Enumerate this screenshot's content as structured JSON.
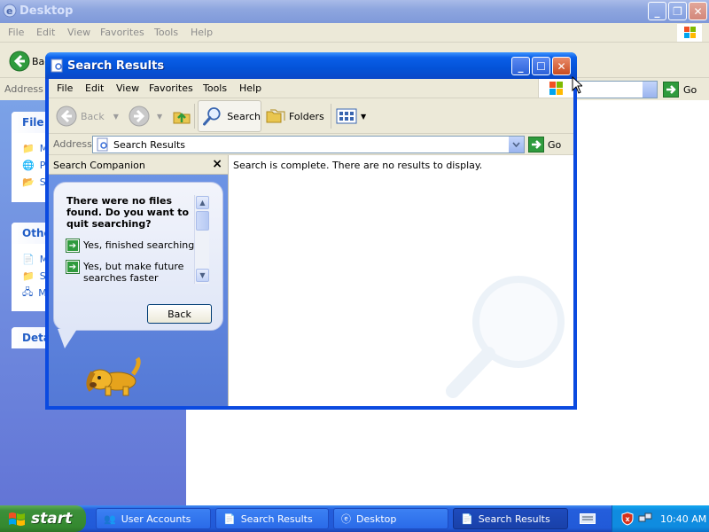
{
  "background_window": {
    "title": "Desktop",
    "menu": [
      "File",
      "Edit",
      "View",
      "Favorites",
      "Tools",
      "Help"
    ],
    "back_label": "Back",
    "address_label": "Address",
    "go_label": "Go",
    "task_boxes": [
      {
        "header": "File a",
        "items": [
          "M",
          "P",
          "S"
        ]
      },
      {
        "header": "Othe",
        "items": [
          "M",
          "S",
          "M"
        ]
      },
      {
        "header": "Deta",
        "items": []
      }
    ]
  },
  "search_window": {
    "title": "Search Results",
    "menu": [
      "File",
      "Edit",
      "View",
      "Favorites",
      "Tools",
      "Help"
    ],
    "toolbar": {
      "back": "Back",
      "search": "Search",
      "folders": "Folders"
    },
    "address": {
      "label": "Address",
      "value": "Search Results",
      "go": "Go"
    },
    "companion": {
      "header": "Search Companion",
      "close_glyph": "×",
      "question": "There were no files found.  Do you want to quit searching?",
      "options": [
        "Yes, finished searching",
        "Yes, but make future searches faster"
      ],
      "back_button": "Back"
    },
    "results_message": "Search is complete. There are no results to display."
  },
  "taskbar": {
    "start_label": "start",
    "tasks": [
      {
        "label": "User Accounts",
        "active": false
      },
      {
        "label": "Search Results",
        "active": false
      },
      {
        "label": "Desktop",
        "active": false
      },
      {
        "label": "Search Results",
        "active": true
      }
    ],
    "clock": "10:40 AM"
  },
  "colors": {
    "title_active": "#0453d8",
    "title_inactive": "#8ea6df",
    "taskbar": "#245edc",
    "start_green": "#3c8f3a",
    "tray": "#0f8ce0"
  }
}
